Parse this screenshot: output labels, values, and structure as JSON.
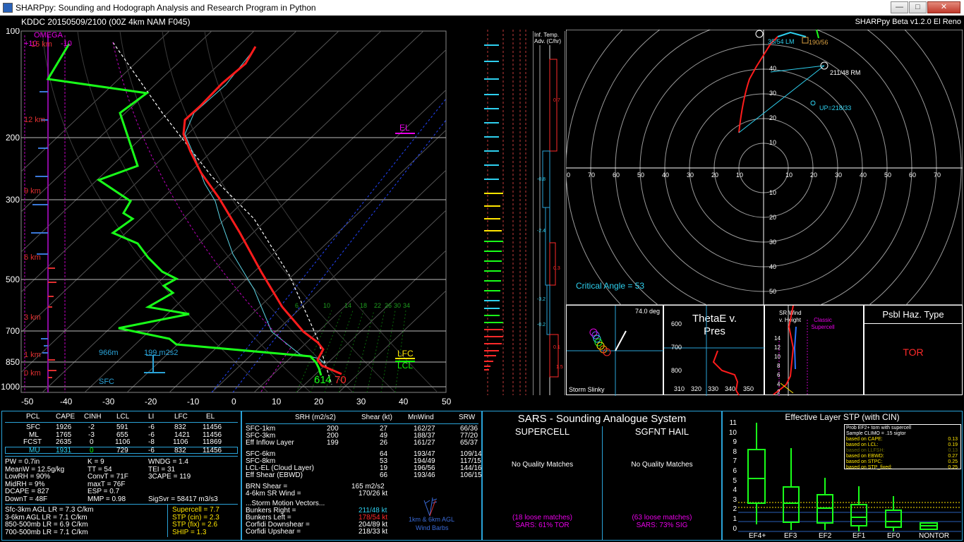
{
  "window": {
    "title": "SHARPpy: Sounding and Hodograph Analysis and Research Program in Python",
    "minimize": "—",
    "maximize": "□",
    "close": "✕"
  },
  "header": {
    "left": "KDDC   20150509/2100   (00Z  4km NAM  F045)",
    "right": "SHARPpy Beta v1.2.0 El Reno"
  },
  "skewt": {
    "p_labels": [
      "100",
      "200",
      "300",
      "500",
      "700",
      "850",
      "1000"
    ],
    "t_labels": [
      "-50",
      "-40",
      "-30",
      "-20",
      "-10",
      "0",
      "10",
      "20",
      "30",
      "40",
      "50"
    ],
    "omega": "OMEGA",
    "omega_scale": "+10",
    "km_labels": [
      "15 km",
      "12 km",
      "9 km",
      "6 km",
      "3 km",
      "1 km",
      "0 km"
    ],
    "omega_top": "-10",
    "el": "EL",
    "lfc": "LFC",
    "lcl": "LCL",
    "sfc_height": "966m",
    "srh_label": "199 m2s2",
    "sfc": "SFC",
    "sfc_t": "70",
    "sfc_td": "61",
    "sfc_td2": "4",
    "mix_labels": [
      "6",
      "10",
      "14",
      "18",
      "22",
      "26",
      "30",
      "34"
    ]
  },
  "advection": {
    "title": "Inf. Temp. Adv. (C/hr)",
    "values": [
      "0.7",
      "-0.8",
      "-2.4",
      "0.3",
      "-3.2",
      "-0.2",
      "0.1",
      "1.5"
    ]
  },
  "hodograph": {
    "lm_label": "35/54 LM",
    "mean_label": "190/56",
    "rm_label": "211/48 RM",
    "up_label": "UP=218/33",
    "rings_top": [
      "40",
      "30",
      "20",
      "10"
    ],
    "rings_bottom": [
      "10",
      "20",
      "30",
      "40",
      "50"
    ],
    "x_labels": [
      "0",
      "70",
      "60",
      "50",
      "40",
      "30",
      "20",
      "10",
      "10",
      "20",
      "30",
      "40",
      "50",
      "60",
      "70"
    ],
    "critical_angle": "Critical Angle = 53"
  },
  "storm_slinky": {
    "angle": "74.0 deg",
    "title": "Storm Slinky"
  },
  "thetae": {
    "title_1": "ThetaE v.",
    "title_2": "Pres",
    "y": [
      "600",
      "700",
      "800"
    ],
    "x": [
      "310",
      "320",
      "330",
      "340",
      "350"
    ]
  },
  "srwind": {
    "title": "SR Wind v. Height",
    "classic": "Classic Supercell",
    "heights": [
      "14",
      "12",
      "10",
      "8",
      "6",
      "4",
      "2"
    ]
  },
  "haz": {
    "title": "Psbl Haz. Type",
    "value": "TOR"
  },
  "parcels": {
    "headers": [
      "PCL",
      "CAPE",
      "CINH",
      "LCL",
      "LI",
      "LFC",
      "EL"
    ],
    "rows": [
      [
        "SFC",
        "1926",
        "-2",
        "591",
        "-6",
        "832",
        "11456"
      ],
      [
        "ML",
        "1765",
        "-3",
        "655",
        "-6",
        "1421",
        "11456"
      ],
      [
        "FCST",
        "2635",
        "0",
        "1106",
        "-8",
        "1106",
        "11869"
      ],
      [
        "MU",
        "1931",
        "0",
        "729",
        "-6",
        "832",
        "11456"
      ]
    ]
  },
  "indices": {
    "col1": [
      "PW = 0.7in",
      "MeanW = 12.5g/kg",
      "LowRH = 90%",
      "MidRH = 9%",
      "DCAPE = 827",
      "DownT = 48F"
    ],
    "col2": [
      "K = 9",
      "TT = 54",
      "ConvT = 71F",
      "maxT = 76F",
      "ESP = 0.7",
      "MMP = 0.98"
    ],
    "col3": [
      "WNDG = 1.4",
      "TEI = 31",
      "3CAPE = 119",
      "",
      "",
      ""
    ],
    "sigsvr": "SigSvr = 58417 m3/s3"
  },
  "lapse": [
    "Sfc-3km AGL LR = 7.3 C/km",
    "3-6km AGL LR = 7.1 C/km",
    "850-500mb LR = 6.9 C/km",
    "700-500mb LR = 7.1 C/km"
  ],
  "composites": [
    "Supercell = 7.7",
    "STP (cin) = 2.3",
    "STP (fix) = 2.6",
    "SHIP = 1.3"
  ],
  "kinematics": {
    "headers": [
      "SRH (m2/s2)",
      "Shear (kt)",
      "MnWind",
      "SRW"
    ],
    "rows": [
      [
        "SFC-1km",
        "200",
        "27",
        "162/27",
        "66/36"
      ],
      [
        "SFC-3km",
        "200",
        "49",
        "188/37",
        "77/20"
      ],
      [
        "Eff Inflow Layer",
        "199",
        "26",
        "161/27",
        "65/37"
      ],
      [
        "",
        "",
        "",
        "",
        ""
      ],
      [
        "SFC-6km",
        "",
        "64",
        "193/47",
        "109/14"
      ],
      [
        "SFC-8km",
        "",
        "53",
        "194/49",
        "117/15"
      ],
      [
        "LCL-EL (Cloud Layer)",
        "",
        "19",
        "196/56",
        "144/16"
      ],
      [
        "Eff Shear (EBWD)",
        "",
        "66",
        "193/46",
        "106/15"
      ]
    ],
    "brn": [
      "BRN Shear =",
      "165 m2/s2"
    ],
    "sr": [
      "4-6km SR Wind =",
      "170/26 kt"
    ],
    "vectors_title": "...Storm Motion Vectors...",
    "vectors": [
      [
        "Bunkers Right =",
        "211/48 kt"
      ],
      [
        "Bunkers Left =",
        "178/54 kt"
      ],
      [
        "Corfidi Downshear =",
        "204/89 kt"
      ],
      [
        "Corfidi Upshear =",
        "218/33 kt"
      ]
    ],
    "barbs_label_1": "1km & 6km AGL",
    "barbs_label_2": "Wind Barbs"
  },
  "sars": {
    "title": "SARS - Sounding Analogue System",
    "supercell": "SUPERCELL",
    "hail": "SGFNT HAIL",
    "sc_match": "No Quality Matches",
    "hail_match": "No Quality Matches",
    "sc_loose": "(18 loose matches)",
    "sc_result": "SARS: 61% TOR",
    "hail_loose": "(63 loose matches)",
    "hail_result": "SARS: 73% SIG"
  },
  "stp": {
    "title": "Effective Layer STP (with CIN)",
    "y": [
      "11",
      "10",
      "9",
      "8",
      "7",
      "6",
      "5",
      "4",
      "3",
      "2",
      "1",
      "0"
    ],
    "cats": [
      "EF4+",
      "EF3",
      "EF2",
      "EF1",
      "EF0",
      "NONTOR"
    ],
    "legend_title": "Prob EF2+ torn with supercell",
    "legend_sub": "Sample CLIMO = .15 sigtor",
    "legend": [
      [
        "based on CAPE:",
        "0.13"
      ],
      [
        "based on LCL:",
        "0.19"
      ],
      [
        "based on LLFSH:",
        "0.13"
      ],
      [
        "based on EBWD:",
        "0.27"
      ],
      [
        "based on STPC:",
        "0.25"
      ],
      [
        "based on STP_fixed:",
        "0.25"
      ]
    ]
  }
}
